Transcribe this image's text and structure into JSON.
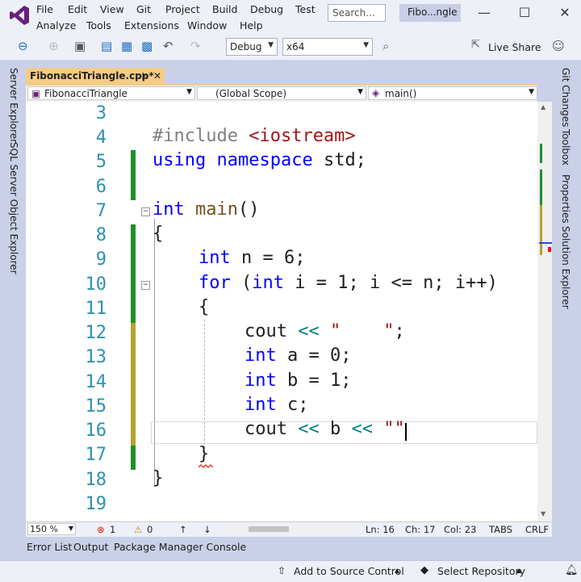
{
  "menu": {
    "row1": [
      "File",
      "Edit",
      "View",
      "Git",
      "Project",
      "Build",
      "Debug",
      "Test"
    ],
    "row2": [
      "Analyze",
      "Tools",
      "Extensions",
      "Window",
      "Help"
    ],
    "search_placeholder": "Search...",
    "solution_title": "Fibo...ngle"
  },
  "toolbar": {
    "config": "Debug",
    "platform": "x64",
    "live_share": "Live Share"
  },
  "left_rail": [
    "Server Explorer",
    "SQL Server Object Explorer"
  ],
  "right_rail": [
    "Git Changes",
    "Toolbox",
    "Properties",
    "Solution Explorer"
  ],
  "document_tab": {
    "title": "FibonacciTriangle.cpp*",
    "pin": "⊹",
    "close": "✕"
  },
  "navbar": {
    "project": "FibonacciTriangle",
    "scope": "(Global Scope)",
    "member": "main()"
  },
  "editor": {
    "line_numbers": [
      "3",
      "4",
      "5",
      "6",
      "7",
      "8",
      "9",
      "10",
      "11",
      "12",
      "13",
      "14",
      "15",
      "16",
      "17",
      "18",
      "19"
    ],
    "lines": {
      "l4_pp": "#include ",
      "l4_str": "<iostream>",
      "l5_kw1": "using",
      "l5_kw2": "namespace",
      "l5_rest": " std;",
      "l7_kw": "int",
      "l7_fn": "main",
      "l7_rest": "()",
      "l8": "{",
      "l9_kw": "int",
      "l9_rest": " n = 6;",
      "l10_kw": "for",
      "l10_a": " (",
      "l10_kw2": "int",
      "l10_b": " i = 1; i <= n; i++)",
      "l11": "{",
      "l12_a": "cout ",
      "l12_op": "<<",
      "l12_str": " \"    \"",
      "l12_end": ";",
      "l13_kw": "int",
      "l13_rest": " a = 0;",
      "l14_kw": "int",
      "l14_rest": " b = 1;",
      "l15_kw": "int",
      "l15_rest": " c;",
      "l16_a": "cout ",
      "l16_op1": "<<",
      "l16_b": " b ",
      "l16_op2": "<<",
      "l16_str": " \"\"",
      "l17": "}",
      "l18": "}"
    }
  },
  "status_strip": {
    "zoom": "150 %",
    "errors": "1",
    "warnings": "0",
    "ln": "Ln: 16",
    "ch": "Ch: 17",
    "col": "Col: 23",
    "tabs": "TABS",
    "eol": "CRLF"
  },
  "bottom_tabs": [
    "Error List",
    "Output",
    "Package Manager Console"
  ],
  "statusbar": {
    "source_control": "Add to Source Control",
    "repository": "Select Repository"
  },
  "colors": {
    "accent_purple": "#68217a",
    "tab_active": "#f5cc84",
    "change_saved": "#1f8f2b",
    "change_unsaved": "#b8a12f",
    "error_red": "#e51400"
  }
}
